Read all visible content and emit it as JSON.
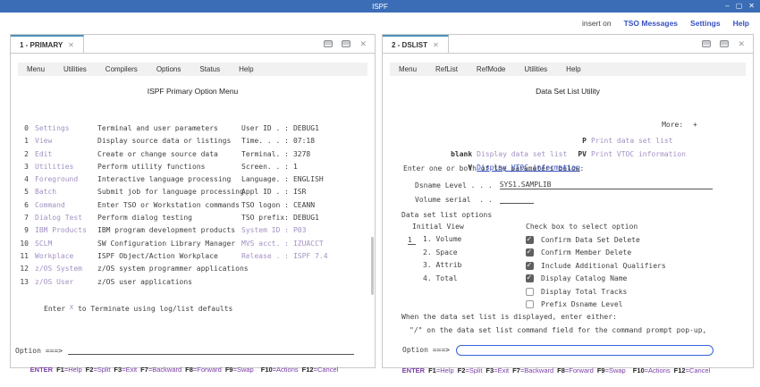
{
  "colors": {
    "titlebar": "#3a6db6",
    "tab_accent": "#4d92bb",
    "link": "#3650c0",
    "purple": "#7b40a8",
    "lavender": "#a391c2",
    "text": "#3f3f3f",
    "input_focus": "#3464d8"
  },
  "window": {
    "title": "ISPF",
    "minimize": "–",
    "maximize": "▢",
    "close": "✕"
  },
  "header": {
    "insert_status": "insert on",
    "links": [
      "TSO Messages",
      "Settings",
      "Help"
    ]
  },
  "fkeys": [
    {
      "k": "ENTER",
      "v": ""
    },
    {
      "k": "F1",
      "v": "=Help"
    },
    {
      "k": "F2",
      "v": "=Split"
    },
    {
      "k": "F3",
      "v": "=Exit"
    },
    {
      "k": "F7",
      "v": "=Backward"
    },
    {
      "k": "F8",
      "v": "=Forward"
    },
    {
      "k": "F9",
      "v": "=Swap"
    },
    {
      "k": "F10",
      "v": "=Actions"
    },
    {
      "k": "F12",
      "v": "=Cancel"
    }
  ],
  "left": {
    "tab": "1 - PRIMARY",
    "tab_close": "✕",
    "menu": [
      "Menu",
      "Utilities",
      "Compilers",
      "Options",
      "Status",
      "Help"
    ],
    "title": "ISPF Primary Option Menu",
    "options": [
      {
        "num": "0",
        "label": "Settings",
        "desc": "Terminal and user parameters"
      },
      {
        "num": "1",
        "label": "View",
        "desc": "Display source data or listings"
      },
      {
        "num": "2",
        "label": "Edit",
        "desc": "Create or change source data"
      },
      {
        "num": "3",
        "label": "Utilities",
        "desc": "Perform utility functions"
      },
      {
        "num": "4",
        "label": "Foreground",
        "desc": "Interactive language processing"
      },
      {
        "num": "5",
        "label": "Batch",
        "desc": "Submit job for language processing"
      },
      {
        "num": "6",
        "label": "Command",
        "desc": "Enter TSO or Workstation commands"
      },
      {
        "num": "7",
        "label": "Dialog Test",
        "desc": "Perform dialog testing"
      },
      {
        "num": "9",
        "label": "IBM Products",
        "desc": "IBM program development products"
      },
      {
        "num": "10",
        "label": "SCLM",
        "desc": "SW Configuration Library Manager"
      },
      {
        "num": "11",
        "label": "Workplace",
        "desc": "ISPF Object/Action Workplace"
      },
      {
        "num": "12",
        "label": "z/OS System",
        "desc": "z/OS system programmer applications"
      },
      {
        "num": "13",
        "label": "z/OS User",
        "desc": "z/OS user applications"
      }
    ],
    "status": [
      {
        "label": "User ID . :",
        "value": "DEBUG1"
      },
      {
        "label": "Time. . . :",
        "value": "07:18"
      },
      {
        "label": "Terminal. :",
        "value": "3278"
      },
      {
        "label": "Screen. . :",
        "value": "1"
      },
      {
        "label": "Language. :",
        "value": "ENGLISH"
      },
      {
        "label": "Appl ID . :",
        "value": "ISR"
      },
      {
        "label": "TSO logon :",
        "value": "CEANN"
      },
      {
        "label": "TSO prefix:",
        "value": "DEBUG1"
      },
      {
        "label": "System ID :",
        "value": "P03"
      },
      {
        "label": "MVS acct. :",
        "value": "IZUACCT"
      },
      {
        "label": "Release . :",
        "value": "ISPF 7.4"
      }
    ],
    "terminate": {
      "pre": "Enter ",
      "x": "X",
      "post": " to Terminate using log/list defaults"
    },
    "prompt": "Option ===>"
  },
  "right": {
    "tab": "2 - DSLIST",
    "tab_close": "✕",
    "menu": [
      "Menu",
      "RefList",
      "RefMode",
      "Utilities",
      "Help"
    ],
    "title": "Data Set List Utility",
    "more": "More:",
    "more_plus": "+",
    "cmds": [
      {
        "key": "blank",
        "desc": "Display data set list"
      },
      {
        "key": "V",
        "desc": "Display VTOC information"
      },
      {
        "key": "P",
        "desc": "Print data set list"
      },
      {
        "key": "PV",
        "desc": "Print VTOC information"
      }
    ],
    "params_heading": "Enter one or both of the parameters below:",
    "dsname_label": "Dsname Level . . .",
    "dsname_value": "SYS1.SAMPLIB",
    "volume_label": "Volume serial  . .",
    "volume_value": "",
    "options_heading": "Data set list options",
    "initial_view": {
      "heading": "Initial View",
      "value": "1",
      "items": [
        "1. Volume",
        "2. Space",
        "3. Attrib",
        "4. Total"
      ]
    },
    "checks": {
      "heading": "Check box to select option",
      "items": [
        {
          "label": "Confirm Data Set Delete",
          "checked": true
        },
        {
          "label": "Confirm Member Delete",
          "checked": true
        },
        {
          "label": "Include Additional Qualifiers",
          "checked": true
        },
        {
          "label": "Display Catalog Name",
          "checked": true
        },
        {
          "label": "Display Total Tracks",
          "checked": false
        },
        {
          "label": "Prefix Dsname Level",
          "checked": false
        }
      ]
    },
    "note1": "When the data set list is displayed, enter either:",
    "note2": "\"/\" on the data set list command field for the command prompt pop-up,",
    "prompt": "Option ===>"
  }
}
